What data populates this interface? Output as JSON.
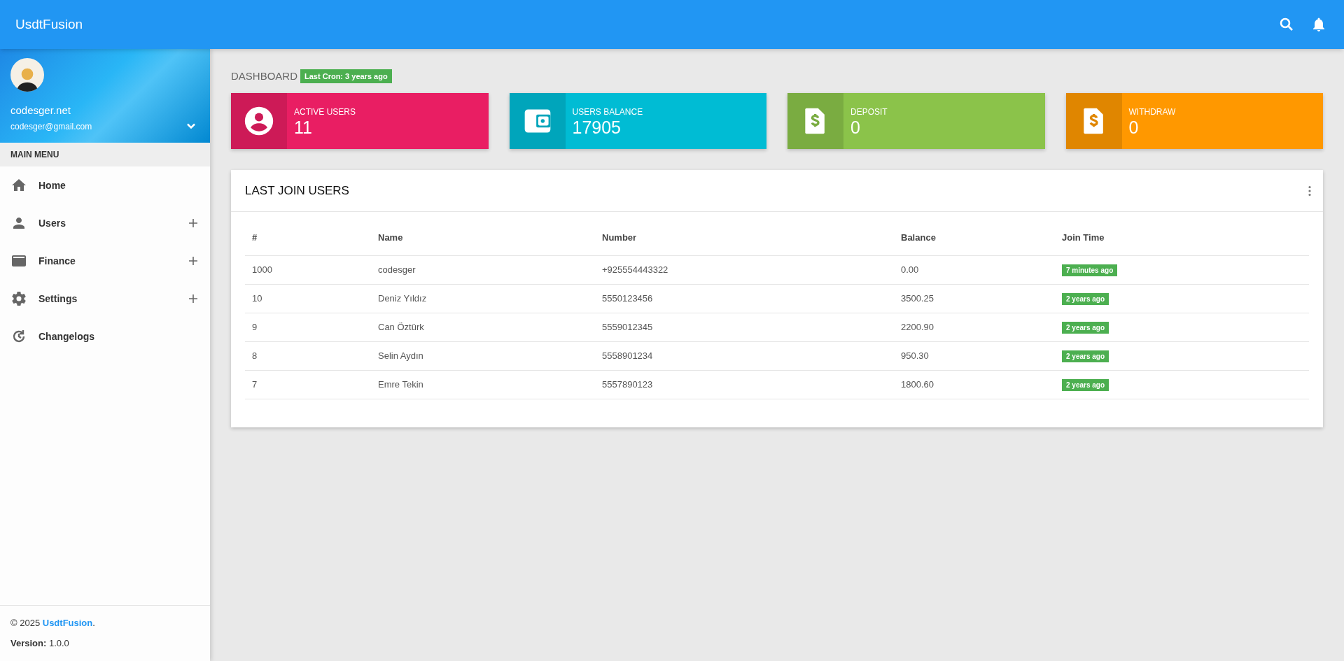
{
  "topbar": {
    "brand": "UsdtFusion"
  },
  "profile": {
    "name": "codesger.net",
    "email": "codesger@gmail.com"
  },
  "menu": {
    "heading": "MAIN MENU",
    "items": [
      {
        "kind": "home",
        "label": "Home",
        "expandable": false
      },
      {
        "kind": "user",
        "label": "Users",
        "expandable": true
      },
      {
        "kind": "card",
        "label": "Finance",
        "expandable": true
      },
      {
        "kind": "gear",
        "label": "Settings",
        "expandable": true
      },
      {
        "kind": "history",
        "label": "Changelogs",
        "expandable": false
      }
    ]
  },
  "footer": {
    "copyright": "© 2025",
    "link": "UsdtFusion",
    "suffix": ".",
    "version_label": "Version:",
    "version": "1.0.0"
  },
  "page": {
    "title": "DASHBOARD",
    "cron": "Last Cron: 3 years ago"
  },
  "stats": [
    {
      "kind": "user",
      "label": "ACTIVE USERS",
      "value": "11",
      "color": "#e91e63"
    },
    {
      "kind": "wallet",
      "label": "USERS BALANCE",
      "value": "17905",
      "color": "#00bcd4"
    },
    {
      "kind": "money",
      "label": "DEPOSIT",
      "value": "0",
      "color": "#8bc34a"
    },
    {
      "kind": "money",
      "label": "WITHDRAW",
      "value": "0",
      "color": "#ff9800"
    }
  ],
  "table": {
    "title": "LAST JOIN USERS",
    "columns": [
      "#",
      "Name",
      "Number",
      "Balance",
      "Join Time"
    ],
    "rows": [
      {
        "id": "1000",
        "name": "codesger",
        "number": "+925554443322",
        "balance": "0.00",
        "joined": "7 minutes ago"
      },
      {
        "id": "10",
        "name": "Deniz Yıldız",
        "number": "5550123456",
        "balance": "3500.25",
        "joined": "2 years ago"
      },
      {
        "id": "9",
        "name": "Can Öztürk",
        "number": "5559012345",
        "balance": "2200.90",
        "joined": "2 years ago"
      },
      {
        "id": "8",
        "name": "Selin Aydın",
        "number": "5558901234",
        "balance": "950.30",
        "joined": "2 years ago"
      },
      {
        "id": "7",
        "name": "Emre Tekin",
        "number": "5557890123",
        "balance": "1800.60",
        "joined": "2 years ago"
      }
    ]
  }
}
